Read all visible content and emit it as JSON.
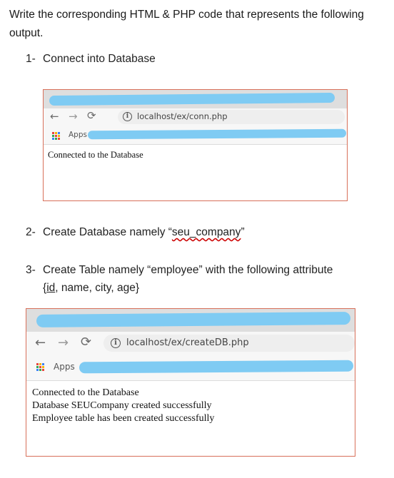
{
  "intro": "Write the corresponding HTML & PHP code that represents the following output.",
  "items": [
    {
      "num": "1-",
      "text": "Connect into Database"
    },
    {
      "num": "2-",
      "text_before": "Create Database namely “",
      "text_marked": "seu_company",
      "text_after": "”"
    },
    {
      "num": "3-",
      "line1": "Create Table namely “employee” with the following attribute",
      "line2_before": "{",
      "line2_marked": "id",
      "line2_after": ", name, city, age}"
    }
  ],
  "browser1": {
    "url": "localhost/ex/conn.php",
    "apps_label": "Apps",
    "content": [
      "Connected to the Database"
    ]
  },
  "browser2": {
    "url": "localhost/ex/createDB.php",
    "apps_label": "Apps",
    "content": [
      "Connected to the Database",
      "Database SEUCompany created successfully",
      "Employee table has been created successfully"
    ]
  },
  "icons": {
    "back": "back-arrow-icon",
    "forward": "forward-arrow-icon",
    "reload": "reload-icon",
    "info": "info-icon",
    "apps": "apps-grid-icon"
  },
  "colors": {
    "frame_border": "#d8705a",
    "redaction": "#7fcbf3",
    "spellcheck": "#cc0000"
  }
}
